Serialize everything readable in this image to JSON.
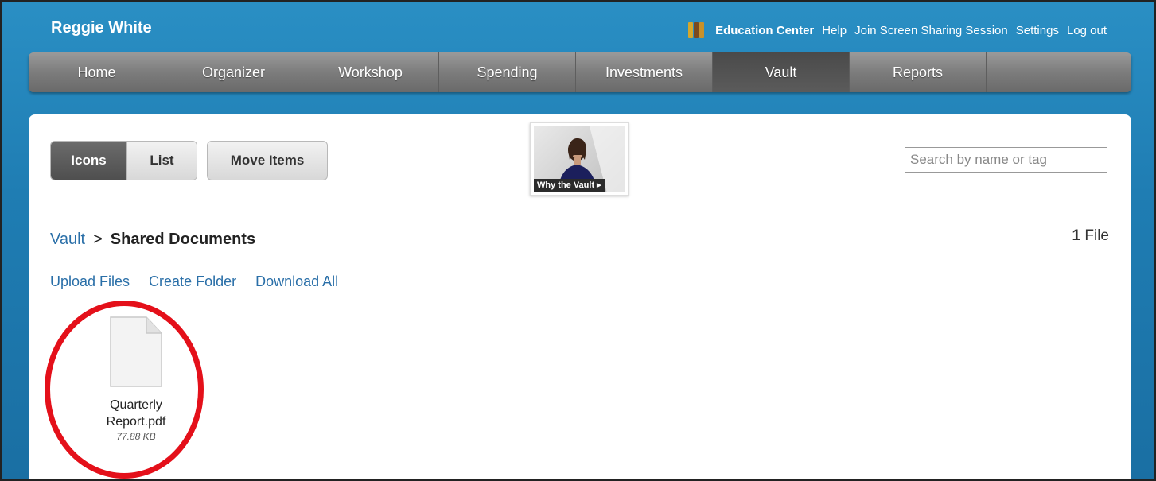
{
  "header": {
    "user_name": "Reggie White",
    "links": {
      "education_center": "Education Center",
      "help": "Help",
      "screen_sharing": "Join Screen Sharing Session",
      "settings": "Settings",
      "logout": "Log out"
    }
  },
  "nav": {
    "items": [
      {
        "label": "Home"
      },
      {
        "label": "Organizer"
      },
      {
        "label": "Workshop"
      },
      {
        "label": "Spending"
      },
      {
        "label": "Investments"
      },
      {
        "label": "Vault",
        "active": true
      },
      {
        "label": "Reports"
      }
    ]
  },
  "toolbar": {
    "view_icons": "Icons",
    "view_list": "List",
    "move_items": "Move Items",
    "video_caption": "Why the Vault ▸",
    "search_placeholder": "Search by name or tag"
  },
  "breadcrumb": {
    "root": "Vault",
    "separator": ">",
    "current": "Shared Documents"
  },
  "file_count": {
    "number": "1",
    "label": "File"
  },
  "actions": {
    "upload": "Upload Files",
    "create_folder": "Create Folder",
    "download_all": "Download All"
  },
  "files": [
    {
      "name_line1": "Quarterly",
      "name_line2": "Report.pdf",
      "size": "77.88 KB"
    }
  ],
  "colors": {
    "header_blue": "#2a8fc4",
    "link_blue": "#2a6fa8",
    "highlight_red": "#e4101a"
  }
}
